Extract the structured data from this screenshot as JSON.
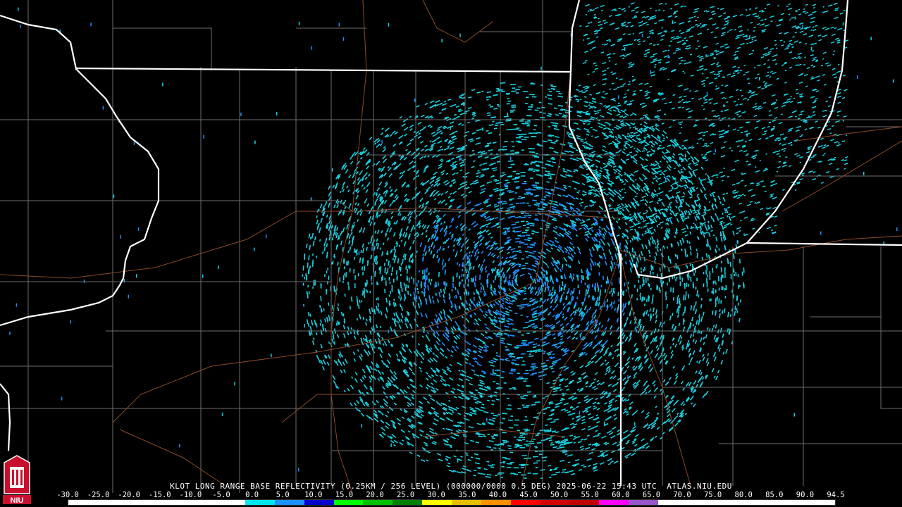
{
  "caption": "KLOT LONG RANGE BASE REFLECTIVITY (0.25KM / 256 LEVEL) (000000/0000 0.5 DEG) 2025-06-22 15:43 UTC  ATLAS.NIU.EDU",
  "scale": {
    "ticks": [
      "-30.0",
      "-25.0",
      "-20.0",
      "-15.0",
      "-10.0",
      "-5.0",
      "0.0",
      "5.0",
      "10.0",
      "15.0",
      "20.0",
      "25.0",
      "30.0",
      "35.0",
      "40.0",
      "45.0",
      "50.0",
      "55.0",
      "60.0",
      "65.0",
      "70.0",
      "75.0",
      "80.0",
      "85.0",
      "90.0",
      "94.5"
    ],
    "colors": [
      "#ffffff",
      "#ffffff",
      "#ffffff",
      "#ffffff",
      "#ffffff",
      "#ffffff",
      "#00e5ee",
      "#1e90ff",
      "#0000cd",
      "#00ff00",
      "#00c000",
      "#008000",
      "#ffff00",
      "#e6c000",
      "#ff9000",
      "#ff0000",
      "#d00000",
      "#c00000",
      "#ff00ff",
      "#9955c9",
      "#ffffff",
      "#ffffff",
      "#ffffff",
      "#ffffff",
      "#ffffff",
      "#ffffff"
    ]
  },
  "logo": {
    "text": "NIU",
    "color": "#c8102e"
  },
  "colors": {
    "state_border": "#ffffff",
    "county_border": "#7a7a7a",
    "highway": "#8b4a2b",
    "echo_light": "#19d0e0",
    "echo_mid": "#1f8fff"
  }
}
